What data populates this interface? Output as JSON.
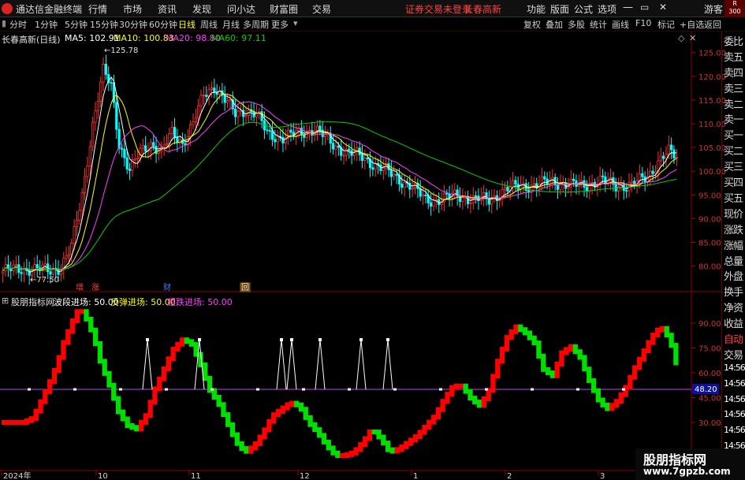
{
  "menu": {
    "app_title": "通达信金融终端",
    "items": [
      "行情",
      "市场",
      "资讯",
      "发现",
      "问小达",
      "财富圈",
      "交易"
    ],
    "notice": "证券交易未登录",
    "stock_name": "长春高新",
    "right_items": [
      "功能",
      "版面",
      "公式",
      "选项"
    ],
    "guest": "游客",
    "badge_top": "R",
    "badge_bottom": "300"
  },
  "toolbar": {
    "periods": [
      "分时",
      "1分钟",
      "5分钟",
      "15分钟",
      "30分钟",
      "60分钟",
      "日线",
      "周线",
      "月线",
      "多周期",
      "更多"
    ],
    "active_period": "日线",
    "tools": [
      "复权",
      "叠加",
      "多股",
      "统计",
      "画线",
      "F10",
      "标记",
      "+自选",
      "返回"
    ]
  },
  "ma_line": {
    "title": "长春高新(日线)",
    "ma5": "MA5: 102.91",
    "ma10": "MA10: 100.83",
    "ma20": "MA20: 98.80",
    "ma60": "MA60: 97.11"
  },
  "indicator_line": {
    "name": "股朋指标网",
    "a": "波段进场: 50.00",
    "b": "反弹进场: 50.00",
    "c": "超跌进场: 50.00"
  },
  "side_panel": [
    "委比",
    "卖五",
    "卖四",
    "卖三",
    "卖二",
    "卖一",
    "买一",
    "买二",
    "买三",
    "买四",
    "买五",
    "现价",
    "涨跌",
    "涨幅",
    "总量",
    "外盘",
    "换手",
    "净资",
    "收益",
    "自动",
    "交易",
    "14:56",
    "14:56",
    "14:56",
    "14:56",
    "14:56",
    "14:56",
    "14:56"
  ],
  "price_axis": [
    "125.00",
    "120.00",
    "115.00",
    "110.00",
    "105.00",
    "100.00",
    "95.00",
    "90.00",
    "85.00",
    "80.00"
  ],
  "ind_axis": [
    "90.00",
    "75.00",
    "60.00",
    "45.00",
    "30.00"
  ],
  "ind_value_box": "48.20",
  "peak_label": "125.78",
  "low_label": "77.50",
  "event_labels": [
    "增",
    "涨",
    "财",
    "回"
  ],
  "date_labels": [
    "2024年",
    "10",
    "11",
    "12",
    "1",
    "2",
    "3"
  ],
  "watermark": {
    "name": "股朋指标网",
    "url": "www.7gpzb.com"
  },
  "colors": {
    "up": "#ff3030",
    "down": "#00ffff",
    "ma5": "#ffffff",
    "ma10": "#ffff00",
    "ma20": "#ff40ff",
    "ma60": "#00d000",
    "wave_up": "#ff0000",
    "wave_down": "#00e000",
    "base_line": "#c040ff"
  }
}
